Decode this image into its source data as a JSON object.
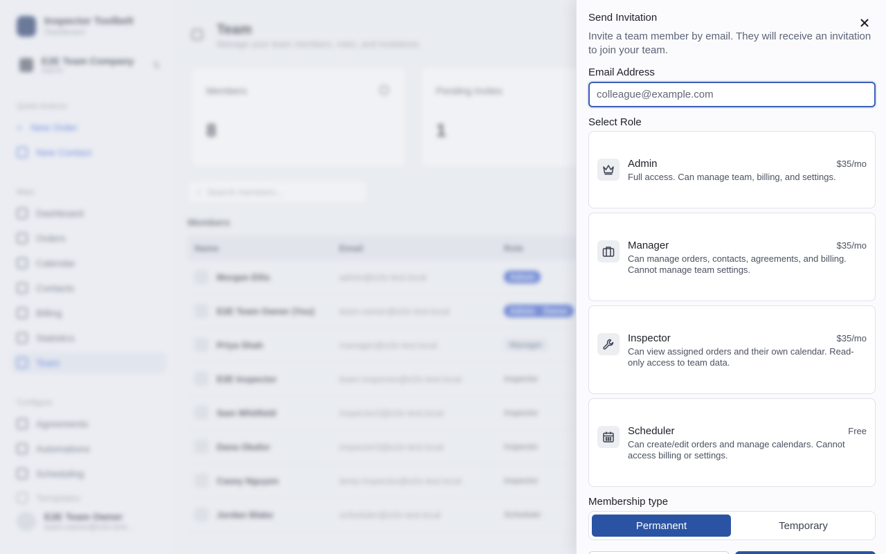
{
  "background": {
    "brand": {
      "name": "Inspector Toolbelt",
      "sub": "Dashboard"
    },
    "company": {
      "name": "E2E Team Company",
      "sub": "Admin"
    },
    "quick_actions_label": "Quick Actions",
    "quick_actions": [
      "New Order",
      "New Contact"
    ],
    "main_label": "Main",
    "main_items": [
      "Dashboard",
      "Orders",
      "Calendar",
      "Contacts",
      "Billing",
      "Statistics",
      "Team"
    ],
    "configure_label": "Configure",
    "configure_items": [
      "Agreements",
      "Automations",
      "Scheduling",
      "Templates"
    ],
    "user": {
      "name": "E2E Team Owner",
      "email": "team-owner@e2e-test..."
    },
    "page": {
      "title": "Team",
      "subtitle": "Manage your team members, roles, and invitations."
    },
    "stats": [
      {
        "label": "Members",
        "value": "8"
      },
      {
        "label": "Pending Invites",
        "value": "1"
      }
    ],
    "search_placeholder": "Search members...",
    "members_heading": "Members",
    "table_headers": [
      "Name",
      "Email",
      "Role"
    ],
    "rows": [
      {
        "name": "Morgan Ellis",
        "email": "admin@e2e-test.local",
        "role": "Admin"
      },
      {
        "name": "E2E Team Owner (You)",
        "email": "team-owner@e2e-test.local",
        "role": "Admin · Owner"
      },
      {
        "name": "Priya Shah",
        "email": "manager@e2e-test.local",
        "role": "Manager"
      },
      {
        "name": "E2E Inspector",
        "email": "team-inspector@e2e-test.local",
        "role": "Inspector"
      },
      {
        "name": "Sam Whitfield",
        "email": "inspector2@e2e-test.local",
        "role": "Inspector"
      },
      {
        "name": "Dana Okafor",
        "email": "inspector3@e2e-test.local",
        "role": "Inspector"
      },
      {
        "name": "Casey Nguyen",
        "email": "temp-inspector@e2e-test.local",
        "role": "Inspector"
      },
      {
        "name": "Jordan Blake",
        "email": "scheduler@e2e-test.local",
        "role": "Scheduler"
      }
    ]
  },
  "panel": {
    "title": "Send Invitation",
    "description": "Invite a team member by email. They will receive an invitation to join your team.",
    "email_label": "Email Address",
    "email_placeholder": "colleague@example.com",
    "email_value": "",
    "role_label": "Select Role",
    "roles": [
      {
        "name": "Admin",
        "price": "$35/mo",
        "description": "Full access. Can manage team, billing, and settings.",
        "icon": "crown-icon"
      },
      {
        "name": "Manager",
        "price": "$35/mo",
        "description": "Can manage orders, contacts, agreements, and billing. Cannot manage team settings.",
        "icon": "briefcase-icon"
      },
      {
        "name": "Inspector",
        "price": "$35/mo",
        "description": "Can view assigned orders and their own calendar. Read-only access to team data.",
        "icon": "wrench-icon"
      },
      {
        "name": "Scheduler",
        "price": "Free",
        "description": "Can create/edit orders and manage calendars. Cannot access billing or settings.",
        "icon": "calendar-icon"
      }
    ],
    "membership_label": "Membership type",
    "membership_options": [
      "Permanent",
      "Temporary"
    ],
    "membership_selected": "Permanent"
  },
  "colors": {
    "accent": "#2a54a3",
    "focus_border": "#3a5fb4",
    "text": "#1c1f26",
    "muted": "#5b6476"
  }
}
